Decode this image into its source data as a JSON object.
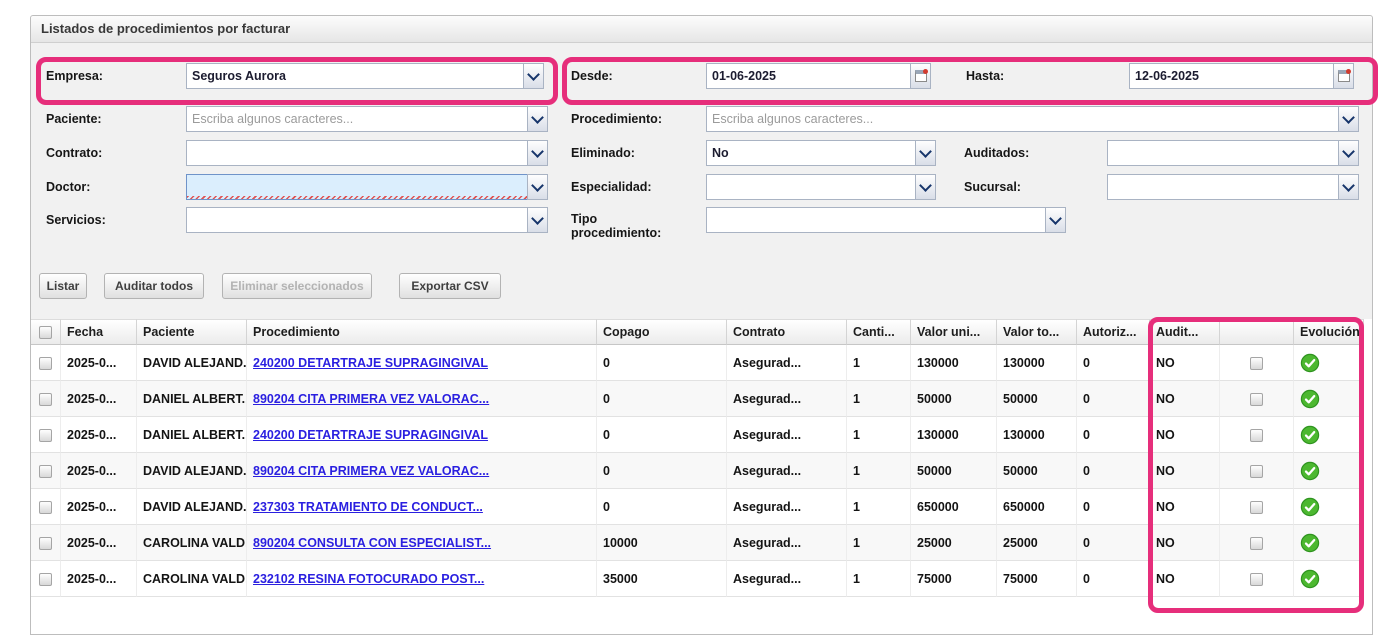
{
  "panel": {
    "title": "Listados de procedimientos por facturar"
  },
  "filters": {
    "empresa": {
      "label": "Empresa:",
      "value": "Seguros Aurora"
    },
    "paciente": {
      "label": "Paciente:",
      "placeholder": "Escriba algunos caracteres..."
    },
    "contrato": {
      "label": "Contrato:",
      "value": ""
    },
    "doctor": {
      "label": "Doctor:",
      "value": ""
    },
    "servicios": {
      "label": "Servicios:",
      "value": ""
    },
    "desde": {
      "label": "Desde:",
      "value": "01-06-2025"
    },
    "hasta": {
      "label": "Hasta:",
      "value": "12-06-2025"
    },
    "procedimiento": {
      "label": "Procedimiento:",
      "placeholder": "Escriba algunos caracteres..."
    },
    "eliminado": {
      "label": "Eliminado:",
      "value": "No"
    },
    "auditados": {
      "label": "Auditados:",
      "value": ""
    },
    "especialidad": {
      "label": "Especialidad:",
      "value": ""
    },
    "sucursal": {
      "label": "Sucursal:",
      "value": ""
    },
    "tipo_procedimiento": {
      "label": "Tipo procedimiento:",
      "value": ""
    }
  },
  "toolbar": {
    "listar": "Listar",
    "auditar_todos": "Auditar todos",
    "eliminar_seleccionados": "Eliminar seleccionados",
    "exportar_csv": "Exportar CSV"
  },
  "table": {
    "headers": [
      "",
      "Fecha",
      "Paciente",
      "Procedimiento",
      "Copago",
      "Contrato",
      "Canti...",
      "Valor uni...",
      "Valor to...",
      "Autoriz...",
      "Audit...",
      "",
      "Evolución"
    ],
    "rows": [
      {
        "fecha": "2025-0...",
        "paciente": "DAVID ALEJAND...",
        "procedimiento": "240200 DETARTRAJE SUPRAGINGIVAL",
        "copago": "0",
        "contrato": "Asegurad...",
        "cantidad": "1",
        "valor_unitario": "130000",
        "valor_total": "130000",
        "autorizado": "0",
        "auditado": "NO"
      },
      {
        "fecha": "2025-0...",
        "paciente": "DANIEL ALBERT...",
        "procedimiento": "890204 CITA PRIMERA VEZ VALORAC...",
        "copago": "0",
        "contrato": "Asegurad...",
        "cantidad": "1",
        "valor_unitario": "50000",
        "valor_total": "50000",
        "autorizado": "0",
        "auditado": "NO"
      },
      {
        "fecha": "2025-0...",
        "paciente": "DANIEL ALBERT...",
        "procedimiento": "240200 DETARTRAJE SUPRAGINGIVAL",
        "copago": "0",
        "contrato": "Asegurad...",
        "cantidad": "1",
        "valor_unitario": "130000",
        "valor_total": "130000",
        "autorizado": "0",
        "auditado": "NO"
      },
      {
        "fecha": "2025-0...",
        "paciente": "DAVID ALEJAND...",
        "procedimiento": "890204 CITA PRIMERA VEZ VALORAC...",
        "copago": "0",
        "contrato": "Asegurad...",
        "cantidad": "1",
        "valor_unitario": "50000",
        "valor_total": "50000",
        "autorizado": "0",
        "auditado": "NO"
      },
      {
        "fecha": "2025-0...",
        "paciente": "DAVID ALEJAND...",
        "procedimiento": "237303 TRATAMIENTO DE CONDUCT...",
        "copago": "0",
        "contrato": "Asegurad...",
        "cantidad": "1",
        "valor_unitario": "650000",
        "valor_total": "650000",
        "autorizado": "0",
        "auditado": "NO"
      },
      {
        "fecha": "2025-0...",
        "paciente": "CAROLINA VALD...",
        "procedimiento": "890204 CONSULTA CON ESPECIALIST...",
        "copago": "10000",
        "contrato": "Asegurad...",
        "cantidad": "1",
        "valor_unitario": "25000",
        "valor_total": "25000",
        "autorizado": "0",
        "auditado": "NO"
      },
      {
        "fecha": "2025-0...",
        "paciente": "CAROLINA VALD...",
        "procedimiento": "232102 RESINA FOTOCURADO POST...",
        "copago": "35000",
        "contrato": "Asegurad...",
        "cantidad": "1",
        "valor_unitario": "75000",
        "valor_total": "75000",
        "autorizado": "0",
        "auditado": "NO"
      }
    ]
  },
  "colors": {
    "annotation_pink": "#e62e7b",
    "link_blue": "#2a1fe0",
    "evolucion_green": "#4cb830"
  },
  "icons": {
    "combo_trigger": "chevron-down-icon",
    "date_trigger": "calendar-icon",
    "evolucion": "check-circle-icon"
  }
}
